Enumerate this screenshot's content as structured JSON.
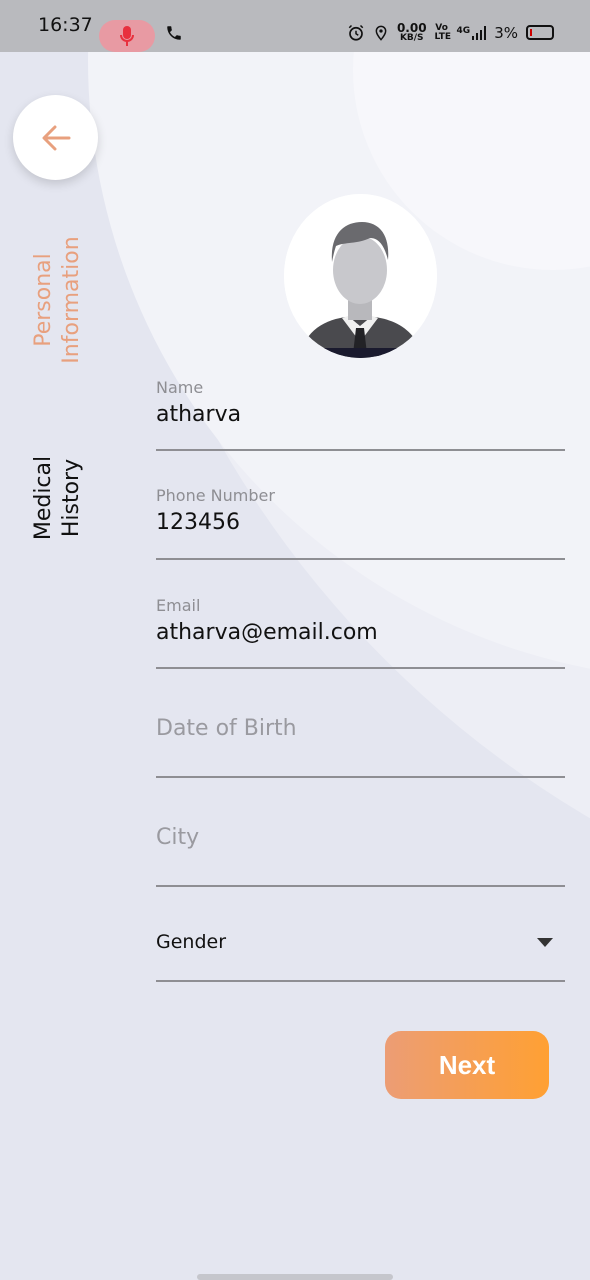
{
  "status_bar": {
    "time": "16:37",
    "net_speed_value": "0.00",
    "net_speed_unit": "KB/S",
    "volte": "Vo LTE",
    "signal": "4G",
    "battery_percent": "3%"
  },
  "tabs": {
    "personal_line1": "Personal",
    "personal_line2": "Information",
    "medical_line1": "Medical",
    "medical_line2": "History"
  },
  "form": {
    "name_label": "Name",
    "name_value": "atharva",
    "phone_label": "Phone Number",
    "phone_value": "123456",
    "email_label": "Email",
    "email_value": "atharva@email.com",
    "dob_placeholder": "Date of Birth",
    "city_placeholder": "City",
    "gender_value": "Gender"
  },
  "actions": {
    "next_label": "Next"
  },
  "colors": {
    "accent": "#e8a07e",
    "button_gradient_start": "#ec9d75",
    "button_gradient_end": "#ffa033",
    "background": "#e4e6f0"
  },
  "icons": {
    "back": "arrow-left-icon",
    "mic": "mic-icon",
    "phone": "phone-icon",
    "alarm": "alarm-icon",
    "location": "location-icon",
    "signal": "signal-icon",
    "battery": "battery-icon",
    "dropdown": "chevron-down-icon",
    "avatar": "avatar-icon"
  }
}
